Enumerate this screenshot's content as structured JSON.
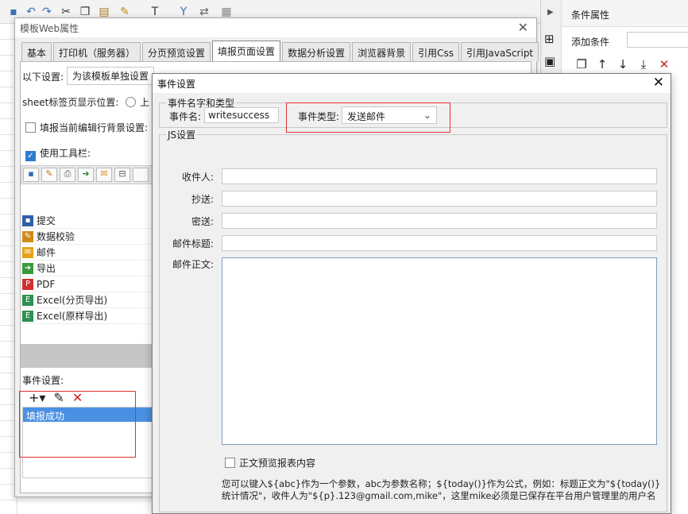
{
  "right_panel": {
    "title": "条件属性",
    "add_condition_label": "添加条件",
    "select_value": "",
    "tool_icons": [
      "copy-icon",
      "arrow-up-icon",
      "arrow-down-icon",
      "move-bottom-icon",
      "delete-icon"
    ]
  },
  "web_window": {
    "title": "模板Web属性",
    "tabs": [
      "基本",
      "打印机（服务器）",
      "分页预览设置",
      "填报页面设置",
      "数据分析设置",
      "浏览器背景",
      "引用Css",
      "引用JavaScript"
    ],
    "active_tab": "填报页面设置",
    "settings_label": "以下设置:",
    "settings_value": "为该模板单独设置",
    "sheet_tab_label": "sheet标签页显示位置:",
    "sheet_tab_option": "上",
    "bg_checkbox_label": "填报当前编辑行背景设置:",
    "use_toolbar_label": "使用工具栏:",
    "toolbar_items": [
      {
        "label": "提交",
        "icon": "save-icon",
        "color": "#2f5fa8"
      },
      {
        "label": "数据校验",
        "icon": "pencil-icon",
        "color": "#d08a1a"
      },
      {
        "label": "邮件",
        "icon": "mail-icon",
        "color": "#e6a21a"
      },
      {
        "label": "导出",
        "icon": "export-icon",
        "color": "#3a9a3a"
      },
      {
        "label": "PDF",
        "icon": "pdf-icon",
        "color": "#d03030"
      },
      {
        "label": "Excel(分页导出)",
        "icon": "excel-icon",
        "color": "#2f8f4f"
      },
      {
        "label": "Excel(原样导出)",
        "icon": "excel-icon",
        "color": "#2f8f4f"
      }
    ],
    "event_settings_label": "事件设置:",
    "event_item": "填报成功"
  },
  "dialog": {
    "title": "事件设置",
    "group_name_type": "事件名字和类型",
    "event_name_label": "事件名:",
    "event_name_value": "writesuccess",
    "event_type_label": "事件类型:",
    "event_type_value": "发送邮件",
    "group_js": "JS设置",
    "recipient_label": "收件人:",
    "cc_label": "抄送:",
    "bcc_label": "密送:",
    "subject_label": "邮件标题:",
    "body_label": "邮件正文:",
    "preview_checkbox_label": "正文预览报表内容",
    "help_text": "您可以键入${abc}作为一个参数，abc为参数名称；${today()}作为公式，例如：标题正文为\"${today()}统计情况\"，收件人为\"${p}.123@gmail.com,mike\"，这里mike必须是已保存在平台用户管理里的用户名"
  }
}
